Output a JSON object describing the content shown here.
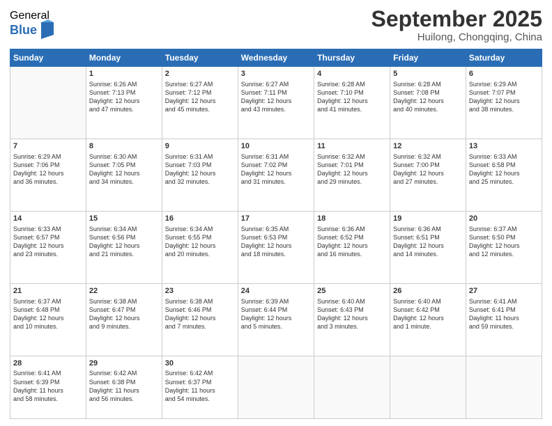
{
  "logo": {
    "general": "General",
    "blue": "Blue"
  },
  "header": {
    "month": "September 2025",
    "location": "Huilong, Chongqing, China"
  },
  "weekdays": [
    "Sunday",
    "Monday",
    "Tuesday",
    "Wednesday",
    "Thursday",
    "Friday",
    "Saturday"
  ],
  "weeks": [
    [
      {
        "day": "",
        "info": ""
      },
      {
        "day": "1",
        "info": "Sunrise: 6:26 AM\nSunset: 7:13 PM\nDaylight: 12 hours\nand 47 minutes."
      },
      {
        "day": "2",
        "info": "Sunrise: 6:27 AM\nSunset: 7:12 PM\nDaylight: 12 hours\nand 45 minutes."
      },
      {
        "day": "3",
        "info": "Sunrise: 6:27 AM\nSunset: 7:11 PM\nDaylight: 12 hours\nand 43 minutes."
      },
      {
        "day": "4",
        "info": "Sunrise: 6:28 AM\nSunset: 7:10 PM\nDaylight: 12 hours\nand 41 minutes."
      },
      {
        "day": "5",
        "info": "Sunrise: 6:28 AM\nSunset: 7:08 PM\nDaylight: 12 hours\nand 40 minutes."
      },
      {
        "day": "6",
        "info": "Sunrise: 6:29 AM\nSunset: 7:07 PM\nDaylight: 12 hours\nand 38 minutes."
      }
    ],
    [
      {
        "day": "7",
        "info": "Sunrise: 6:29 AM\nSunset: 7:06 PM\nDaylight: 12 hours\nand 36 minutes."
      },
      {
        "day": "8",
        "info": "Sunrise: 6:30 AM\nSunset: 7:05 PM\nDaylight: 12 hours\nand 34 minutes."
      },
      {
        "day": "9",
        "info": "Sunrise: 6:31 AM\nSunset: 7:03 PM\nDaylight: 12 hours\nand 32 minutes."
      },
      {
        "day": "10",
        "info": "Sunrise: 6:31 AM\nSunset: 7:02 PM\nDaylight: 12 hours\nand 31 minutes."
      },
      {
        "day": "11",
        "info": "Sunrise: 6:32 AM\nSunset: 7:01 PM\nDaylight: 12 hours\nand 29 minutes."
      },
      {
        "day": "12",
        "info": "Sunrise: 6:32 AM\nSunset: 7:00 PM\nDaylight: 12 hours\nand 27 minutes."
      },
      {
        "day": "13",
        "info": "Sunrise: 6:33 AM\nSunset: 6:58 PM\nDaylight: 12 hours\nand 25 minutes."
      }
    ],
    [
      {
        "day": "14",
        "info": "Sunrise: 6:33 AM\nSunset: 6:57 PM\nDaylight: 12 hours\nand 23 minutes."
      },
      {
        "day": "15",
        "info": "Sunrise: 6:34 AM\nSunset: 6:56 PM\nDaylight: 12 hours\nand 21 minutes."
      },
      {
        "day": "16",
        "info": "Sunrise: 6:34 AM\nSunset: 6:55 PM\nDaylight: 12 hours\nand 20 minutes."
      },
      {
        "day": "17",
        "info": "Sunrise: 6:35 AM\nSunset: 6:53 PM\nDaylight: 12 hours\nand 18 minutes."
      },
      {
        "day": "18",
        "info": "Sunrise: 6:36 AM\nSunset: 6:52 PM\nDaylight: 12 hours\nand 16 minutes."
      },
      {
        "day": "19",
        "info": "Sunrise: 6:36 AM\nSunset: 6:51 PM\nDaylight: 12 hours\nand 14 minutes."
      },
      {
        "day": "20",
        "info": "Sunrise: 6:37 AM\nSunset: 6:50 PM\nDaylight: 12 hours\nand 12 minutes."
      }
    ],
    [
      {
        "day": "21",
        "info": "Sunrise: 6:37 AM\nSunset: 6:48 PM\nDaylight: 12 hours\nand 10 minutes."
      },
      {
        "day": "22",
        "info": "Sunrise: 6:38 AM\nSunset: 6:47 PM\nDaylight: 12 hours\nand 9 minutes."
      },
      {
        "day": "23",
        "info": "Sunrise: 6:38 AM\nSunset: 6:46 PM\nDaylight: 12 hours\nand 7 minutes."
      },
      {
        "day": "24",
        "info": "Sunrise: 6:39 AM\nSunset: 6:44 PM\nDaylight: 12 hours\nand 5 minutes."
      },
      {
        "day": "25",
        "info": "Sunrise: 6:40 AM\nSunset: 6:43 PM\nDaylight: 12 hours\nand 3 minutes."
      },
      {
        "day": "26",
        "info": "Sunrise: 6:40 AM\nSunset: 6:42 PM\nDaylight: 12 hours\nand 1 minute."
      },
      {
        "day": "27",
        "info": "Sunrise: 6:41 AM\nSunset: 6:41 PM\nDaylight: 11 hours\nand 59 minutes."
      }
    ],
    [
      {
        "day": "28",
        "info": "Sunrise: 6:41 AM\nSunset: 6:39 PM\nDaylight: 11 hours\nand 58 minutes."
      },
      {
        "day": "29",
        "info": "Sunrise: 6:42 AM\nSunset: 6:38 PM\nDaylight: 11 hours\nand 56 minutes."
      },
      {
        "day": "30",
        "info": "Sunrise: 6:42 AM\nSunset: 6:37 PM\nDaylight: 11 hours\nand 54 minutes."
      },
      {
        "day": "",
        "info": ""
      },
      {
        "day": "",
        "info": ""
      },
      {
        "day": "",
        "info": ""
      },
      {
        "day": "",
        "info": ""
      }
    ]
  ]
}
